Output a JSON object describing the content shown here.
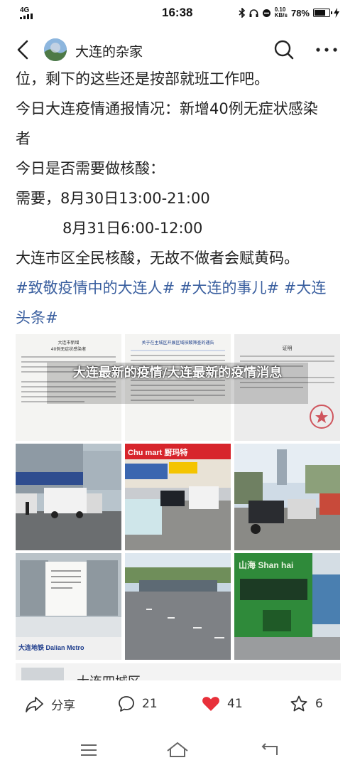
{
  "status_bar": {
    "signal": "4G",
    "time": "16:38",
    "speed_value": "0.10",
    "speed_unit": "KB/s",
    "battery_text": "78%",
    "battery_level": 0.78
  },
  "header": {
    "title": "大连的杂家",
    "back_icon": "back-chevron-icon",
    "search_icon": "search-icon",
    "more_icon": "more-dots-icon"
  },
  "post": {
    "lines": [
      "位，剩下的这些还是按部就班工作吧。",
      "今日大连疫情通报情况：新增40例无症状感染",
      "者",
      "今日是否需要做核酸：",
      "需要，8月30日13:00-21:00",
      "8月31日6:00-12:00",
      "大连市区全民核酸，无故不做者会赋黄码。",
      "#致敬疫情中的大连人# #大连的事儿# #大连",
      "头条#"
    ]
  },
  "overlay": {
    "title": "大连最新的疫情/大连最新的疫情消息"
  },
  "images": {
    "doc1_title": "大连市新增\n40例无症状感染者",
    "doc2_title": "关于在主城区开展区域核酸筛查的通告",
    "doc3_title": "证明",
    "store_sign": "Chu mart 厨玛特",
    "metro_sign": "大连地铁 Dalian Metro",
    "bus_sign": "山海 Shan hai"
  },
  "preview": {
    "text": "大连四城区"
  },
  "actions": {
    "share_label": "分享",
    "comment_count": "21",
    "like_count": "41",
    "favorite_count": "6"
  },
  "colors": {
    "hashtag": "#3a5f9f",
    "like_heart": "#e8303a"
  }
}
